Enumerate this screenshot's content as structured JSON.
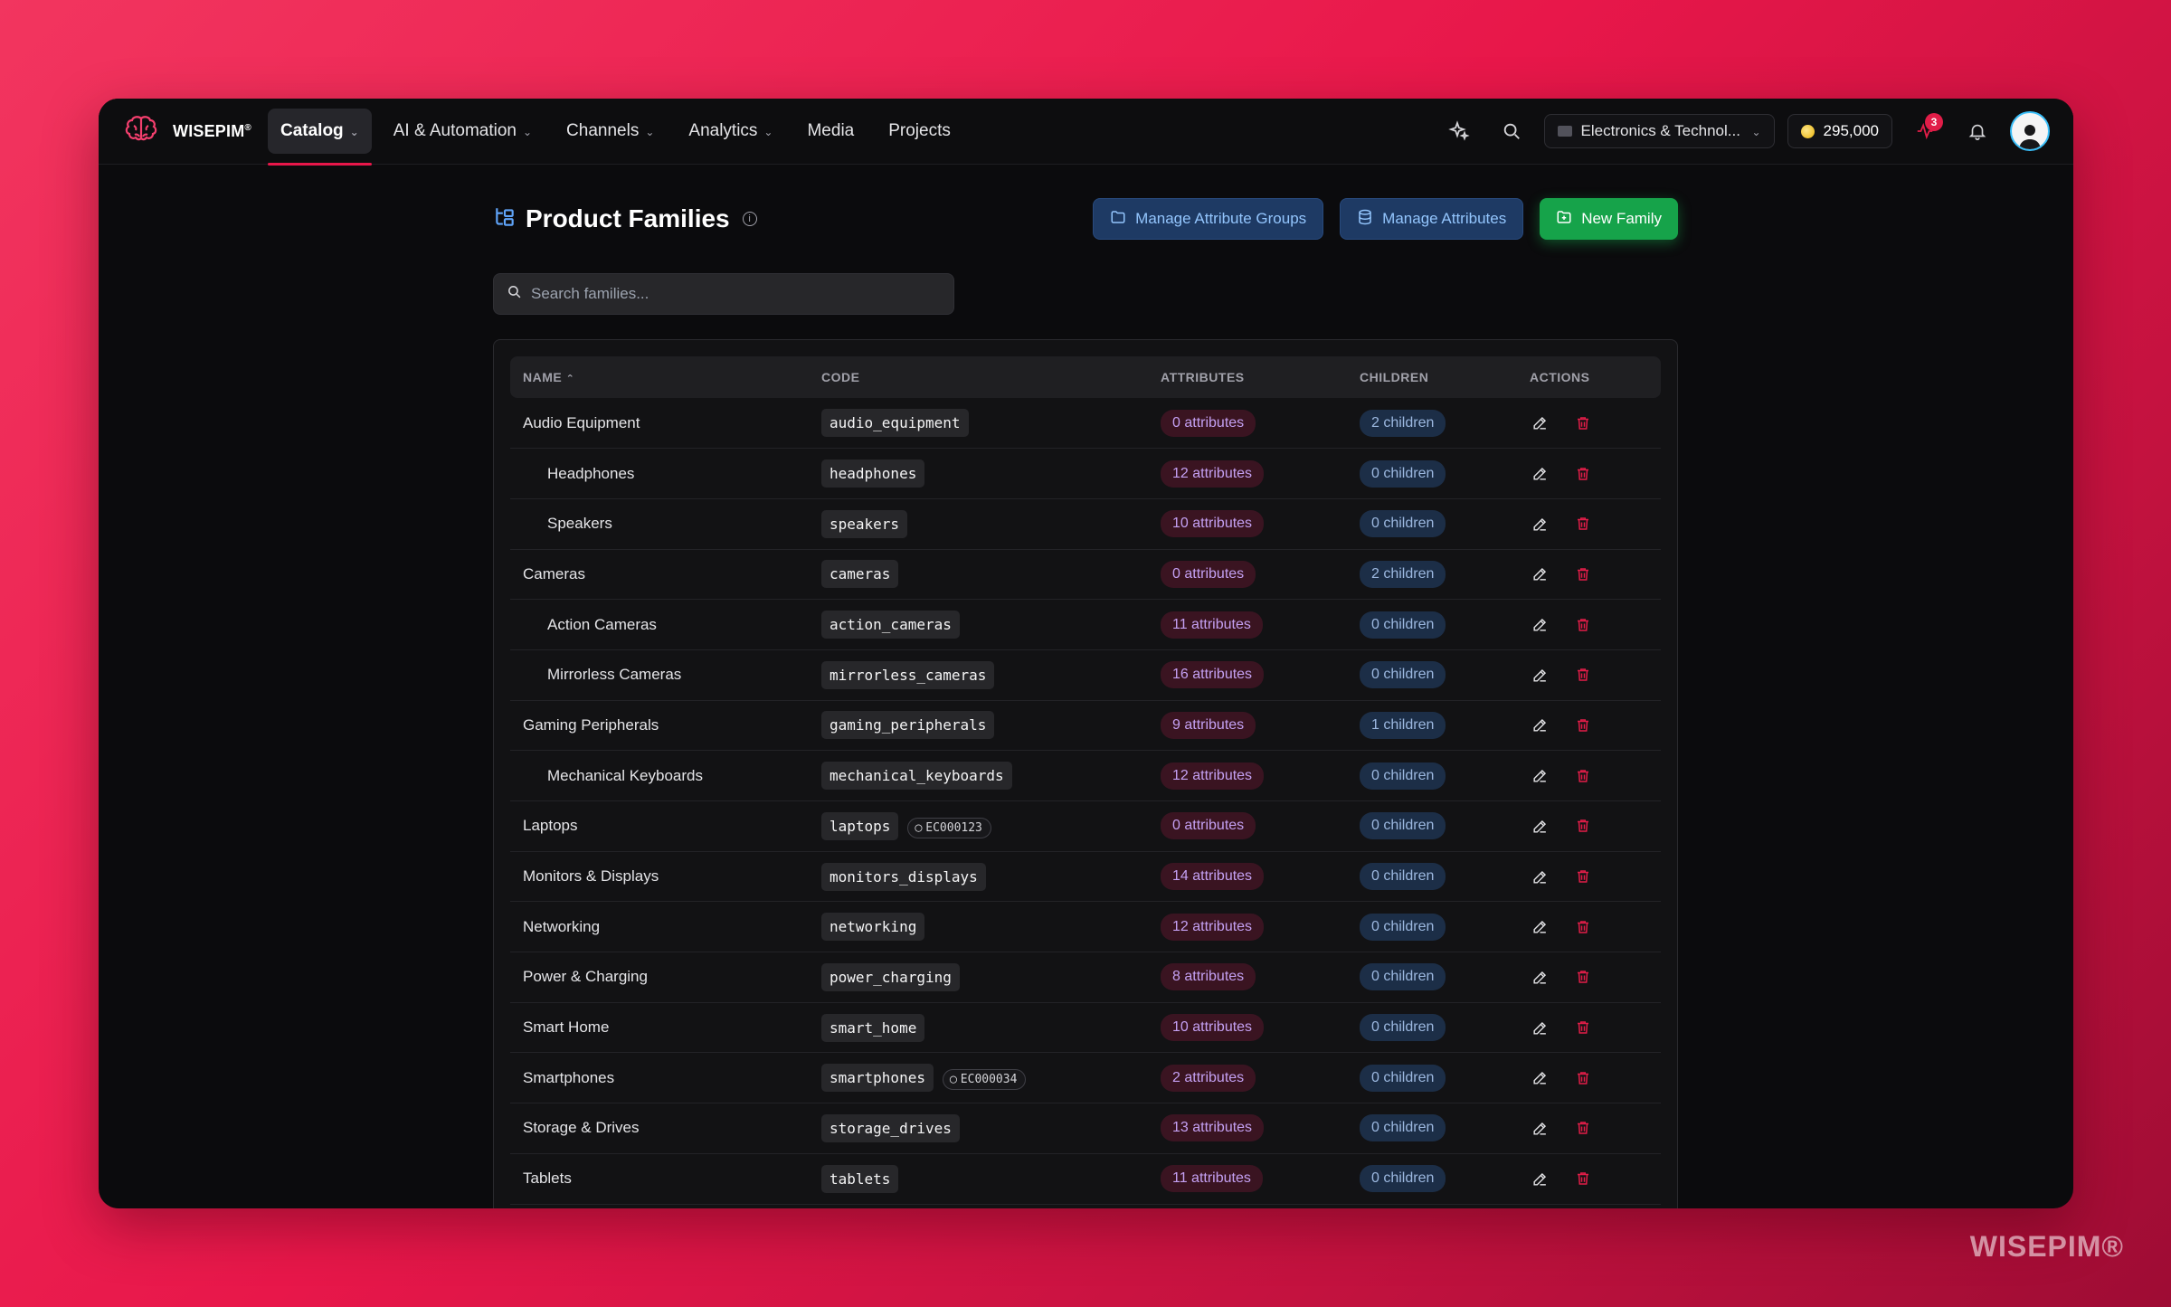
{
  "brand": {
    "name": "WISEPIM",
    "mark": "®"
  },
  "nav": {
    "items": [
      {
        "label": "Catalog",
        "dropdown": true,
        "active": true
      },
      {
        "label": "AI & Automation",
        "dropdown": true
      },
      {
        "label": "Channels",
        "dropdown": true
      },
      {
        "label": "Analytics",
        "dropdown": true
      },
      {
        "label": "Media",
        "dropdown": false
      },
      {
        "label": "Projects",
        "dropdown": false
      }
    ],
    "store": "Electronics & Technol...",
    "credits": "295,000",
    "notification_count": "3"
  },
  "page": {
    "title": "Product Families",
    "buttons": {
      "attribute_groups": "Manage Attribute Groups",
      "attributes": "Manage Attributes",
      "new_family": "New Family"
    },
    "search_placeholder": "Search families..."
  },
  "table": {
    "columns": {
      "name": "NAME",
      "code": "CODE",
      "attributes": "ATTRIBUTES",
      "children": "CHILDREN",
      "actions": "ACTIONS"
    },
    "rows": [
      {
        "name": "Audio Equipment",
        "code": "audio_equipment",
        "ec": "",
        "attributes": "0 attributes",
        "children": "2 children",
        "child": false
      },
      {
        "name": "Headphones",
        "code": "headphones",
        "ec": "",
        "attributes": "12 attributes",
        "children": "0 children",
        "child": true
      },
      {
        "name": "Speakers",
        "code": "speakers",
        "ec": "",
        "attributes": "10 attributes",
        "children": "0 children",
        "child": true
      },
      {
        "name": "Cameras",
        "code": "cameras",
        "ec": "",
        "attributes": "0 attributes",
        "children": "2 children",
        "child": false
      },
      {
        "name": "Action Cameras",
        "code": "action_cameras",
        "ec": "",
        "attributes": "11 attributes",
        "children": "0 children",
        "child": true
      },
      {
        "name": "Mirrorless Cameras",
        "code": "mirrorless_cameras",
        "ec": "",
        "attributes": "16 attributes",
        "children": "0 children",
        "child": true
      },
      {
        "name": "Gaming Peripherals",
        "code": "gaming_peripherals",
        "ec": "",
        "attributes": "9 attributes",
        "children": "1 children",
        "child": false
      },
      {
        "name": "Mechanical Keyboards",
        "code": "mechanical_keyboards",
        "ec": "",
        "attributes": "12 attributes",
        "children": "0 children",
        "child": true
      },
      {
        "name": "Laptops",
        "code": "laptops",
        "ec": "EC000123",
        "attributes": "0 attributes",
        "children": "0 children",
        "child": false
      },
      {
        "name": "Monitors & Displays",
        "code": "monitors_displays",
        "ec": "",
        "attributes": "14 attributes",
        "children": "0 children",
        "child": false
      },
      {
        "name": "Networking",
        "code": "networking",
        "ec": "",
        "attributes": "12 attributes",
        "children": "0 children",
        "child": false
      },
      {
        "name": "Power & Charging",
        "code": "power_charging",
        "ec": "",
        "attributes": "8 attributes",
        "children": "0 children",
        "child": false
      },
      {
        "name": "Smart Home",
        "code": "smart_home",
        "ec": "",
        "attributes": "10 attributes",
        "children": "0 children",
        "child": false
      },
      {
        "name": "Smartphones",
        "code": "smartphones",
        "ec": "EC000034",
        "attributes": "2 attributes",
        "children": "0 children",
        "child": false
      },
      {
        "name": "Storage & Drives",
        "code": "storage_drives",
        "ec": "",
        "attributes": "13 attributes",
        "children": "0 children",
        "child": false
      },
      {
        "name": "Tablets",
        "code": "tablets",
        "ec": "",
        "attributes": "11 attributes",
        "children": "0 children",
        "child": false
      }
    ]
  },
  "watermark": "WISEPIM®",
  "colors": {
    "accent": "#e8174a",
    "green": "#16a34a",
    "blue_button": "#1e3a64",
    "delete": "#e11d48"
  }
}
